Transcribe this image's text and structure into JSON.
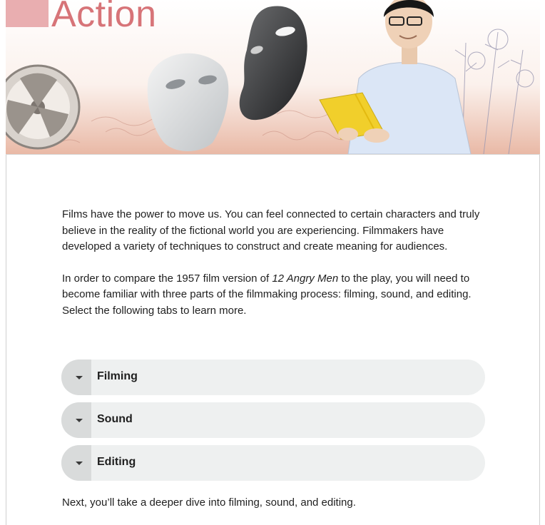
{
  "banner": {
    "title": "Action",
    "colors": {
      "title": "#d77478",
      "title_block": "#e9aeb0",
      "book": "#f1cf2b",
      "shirt": "#dbe6f6"
    },
    "icons": [
      "film-reel-icon",
      "white-mask-icon",
      "black-mask-icon",
      "reading-student-icon",
      "yellow-book-icon"
    ]
  },
  "intro": {
    "paragraph1": "Films have the power to move us. You can feel connected to certain characters and truly believe in the reality of the fictional world you are experiencing. Filmmakers have developed a variety of techniques to construct and create meaning for audiences.",
    "paragraph2_before": "In order to compare the 1957 film version of ",
    "paragraph2_italic": "12 Angry Men",
    "paragraph2_after": " to the play, you will need to become familiar with three parts of the filmmaking process: filming, sound, and editing. Select the following tabs to learn more."
  },
  "accordion": {
    "items": [
      {
        "label": "Filming",
        "expanded": false
      },
      {
        "label": "Sound",
        "expanded": false
      },
      {
        "label": "Editing",
        "expanded": false
      }
    ]
  },
  "footer": {
    "text": "Next, you’ll take a deeper dive into filming, sound, and editing."
  }
}
